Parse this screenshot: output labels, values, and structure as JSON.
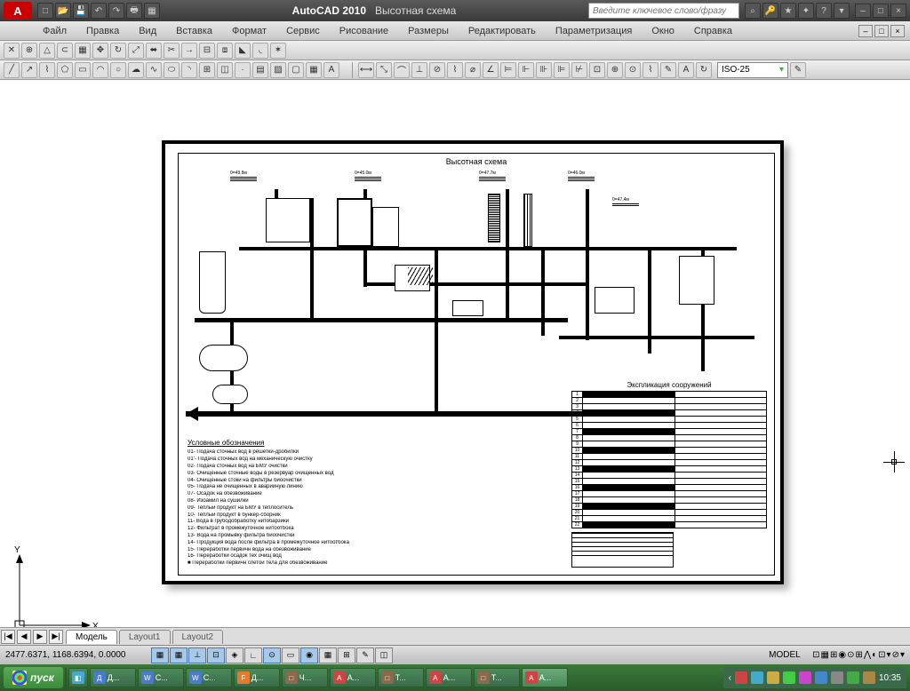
{
  "app": {
    "name": "AutoCAD 2010",
    "doc": "Высотная схема"
  },
  "qat_icons": [
    "new",
    "open",
    "save",
    "undo",
    "redo",
    "print",
    "plot"
  ],
  "search_placeholder": "Введите ключевое слово/фразу",
  "title_icons": [
    "binoculars",
    "key",
    "star",
    "star",
    "help",
    "down"
  ],
  "win_controls": [
    "–",
    "□",
    "×"
  ],
  "menus": [
    "Файл",
    "Правка",
    "Вид",
    "Вставка",
    "Формат",
    "Сервис",
    "Рисование",
    "Размеры",
    "Редактировать",
    "Параметризация",
    "Окно",
    "Справка"
  ],
  "doc_controls": [
    "–",
    "□",
    "×"
  ],
  "toolbar1_icons": [
    "",
    "",
    "",
    "",
    "",
    "",
    "",
    "",
    "",
    "",
    "",
    "",
    "",
    "",
    "",
    "",
    "",
    "",
    ""
  ],
  "toolbar2_draw": [
    "line",
    "pline",
    "poly",
    "rect",
    "arc",
    "circle",
    "spline",
    "ellipse",
    "earc",
    "cloud",
    "hatch",
    "grad",
    "region",
    "table",
    "point",
    "mtext"
  ],
  "toolbar2_annot": [
    "dim1",
    "dim2",
    "dim3",
    "dim4",
    "dim5",
    "dim6",
    "dim7",
    "dim8",
    "dim9",
    "dim10",
    "dim11",
    "dim12",
    "dim13",
    "dim14",
    "dim15",
    "dim16",
    "dim17",
    "dim18",
    "dim19",
    "dim20",
    "dim21",
    "dim22"
  ],
  "dimstyle": "ISO-25",
  "tabs": {
    "nav": [
      "|◀",
      "◀",
      "▶",
      "▶|"
    ],
    "model": "Модель",
    "layouts": [
      "Layout1",
      "Layout2"
    ]
  },
  "status": {
    "coords": "2477.6371, 1168.6394, 0.0000",
    "buttons": [
      "▦",
      "▦",
      "⊥",
      "⊡",
      "◈",
      "∟",
      "⊙",
      "▭",
      "◉",
      "▦",
      "⊞",
      "✎",
      "◫"
    ],
    "right": [
      "MODEL",
      "⊡",
      "▦",
      "⊞",
      "◉",
      "⊙",
      "⊞",
      "⋀",
      "◐",
      "⊡",
      "▾",
      "⊘",
      "▾"
    ]
  },
  "taskbar": {
    "start": "пуск",
    "items": [
      {
        "ico": "Д",
        "label": "Д...",
        "color": "#4a7aca"
      },
      {
        "ico": "W",
        "label": "С...",
        "color": "#4a7aca"
      },
      {
        "ico": "W",
        "label": "С...",
        "color": "#4a7aca"
      },
      {
        "ico": "F",
        "label": "Д...",
        "color": "#e67a2a"
      },
      {
        "ico": "□",
        "label": "Ч...",
        "color": "#8a6a4a"
      },
      {
        "ico": "A",
        "label": "A...",
        "color": "#c44"
      },
      {
        "ico": "□",
        "label": "T...",
        "color": "#8a6a4a"
      },
      {
        "ico": "A",
        "label": "A...",
        "color": "#c44"
      },
      {
        "ico": "□",
        "label": "T...",
        "color": "#8a6a4a"
      },
      {
        "ico": "A",
        "label": "A...",
        "color": "#c44",
        "active": true
      }
    ],
    "tray_icons": [
      "",
      "",
      "",
      "",
      "",
      "",
      "",
      "",
      "",
      "",
      "",
      ""
    ],
    "clock": "10:35"
  },
  "drawing": {
    "title": "Высотная схема",
    "callouts": [
      "0=49.8м",
      "0=45.0м",
      "0=47.7м",
      "0=46.0м",
      "0=47.4м"
    ],
    "legend_title": "Условные обозначения",
    "legend_items": [
      "01- Подача сточных вод в решетки-дробилки",
      "01'- Подача сточных вод на механическую очистку",
      "02- Подача сточных вод на БМУ очистки",
      "03- Очищенные сточные воды в резервуар очищенных вод",
      "04- Очищенные стоки на фильтры биоочистки",
      "05- Подача не очищенных в аварийную линию",
      "07- Осадок на обезвоживание",
      "08- Изоамил на сушилки",
      "09- Теплый продукт на БМУ в теплоситель",
      "10- Теплый продукт в бункер-сборник",
      "11- Вода в грубодобработку нитобарзики",
      "12- Фильтрат в промежуточное нитоотбока",
      "13- Вода на промывку фильтра биоочистки",
      "14- Продукция вода после фильтра в промежуточное нитоотбока",
      "15- Переработки первичн вода на обезвоживание",
      "16- Переработки осадок тех очищ вод",
      "■ Переработки первичн спетой тела для обезвоживание"
    ],
    "explication_title": "Экспликация сооружений",
    "explication_rows": 22
  },
  "ucs": {
    "x": "X",
    "y": "Y"
  }
}
